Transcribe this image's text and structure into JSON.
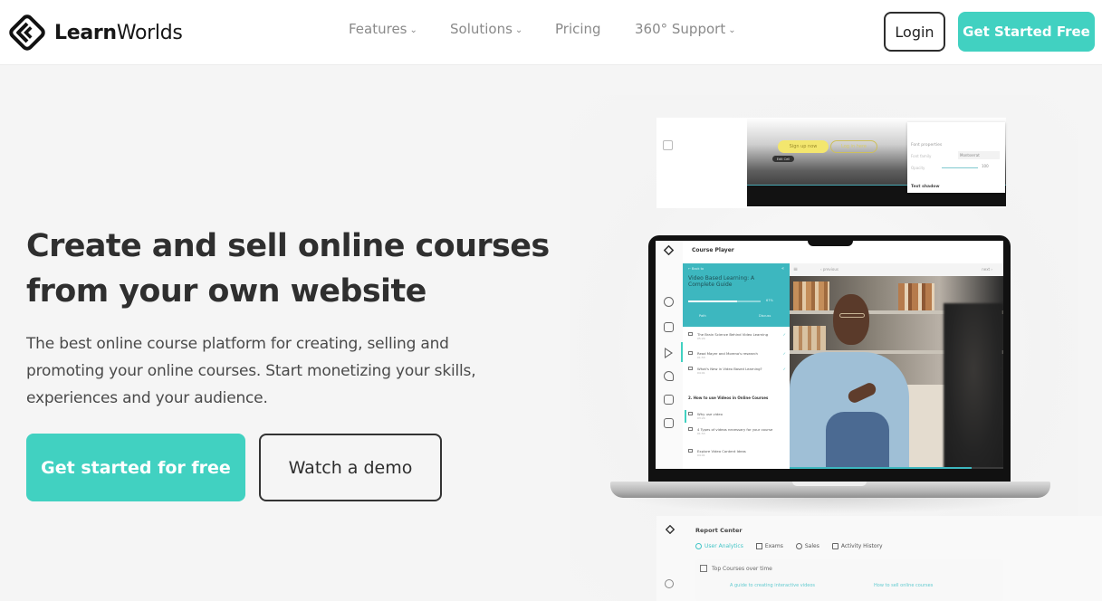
{
  "header": {
    "brand": {
      "bold": "Learn",
      "regular": "Worlds"
    },
    "nav": [
      {
        "label": "Features",
        "has_dropdown": true
      },
      {
        "label": "Solutions",
        "has_dropdown": true
      },
      {
        "label": "Pricing",
        "has_dropdown": false
      },
      {
        "label": "360° Support",
        "has_dropdown": true
      }
    ],
    "login_label": "Login",
    "cta_label": "Get Started Free"
  },
  "hero": {
    "title_line1": "Create and sell online courses",
    "title_line2": "from your own website",
    "subtitle": "The best online course platform for creating, selling and promoting your online courses. Start monetizing your skills, experiences and your audience.",
    "primary_cta": "Get started for free",
    "secondary_cta": "Watch a demo"
  },
  "colors": {
    "accent": "#41d1c1",
    "course_header": "#3db7bf",
    "text_dark": "#2f2f2f",
    "nav_text": "#8a8a8a"
  },
  "builder_preview": {
    "signup_button": "Sign up now",
    "login_button": "Log in here",
    "edit_tag": "Edit Cell",
    "panel_title": "Font properties",
    "font_family_label": "Font family",
    "font_family_value": "Montserrat",
    "opacity_label": "Opacity",
    "opacity_value": "100",
    "text_shadow_label": "Text shadow"
  },
  "course_player": {
    "app_title": "Course Player",
    "back_label": "← Back to",
    "collapse_icon": "«",
    "course_title": "Video Based Learning: A Complete Guide",
    "progress_percent": 67,
    "progress_label": "67%",
    "tabs": [
      "Path",
      "Discuss"
    ],
    "nav_prev": "‹  previous",
    "nav_next": "next  ›",
    "lessons_section1": [
      {
        "title": "The Brain Science Behind Video Learning",
        "duration": "05:24",
        "done": true
      },
      {
        "title": "Read Mayer and Moreno's research",
        "duration": "01:53",
        "done": true
      },
      {
        "title": "What's New in Video Based Learning?",
        "duration": "04:01",
        "done": true
      }
    ],
    "section2_title": "2. How to use Videos in Online Courses",
    "lessons_section2": [
      {
        "title": "Why use video",
        "duration": "03:24",
        "done": false
      },
      {
        "title": "4 Types of videos necessary for your course",
        "duration": "01:53",
        "done": false
      },
      {
        "title": "Explore Video Content Ideas",
        "duration": "04:01",
        "done": false
      }
    ],
    "video_progress_percent": 85
  },
  "report_center": {
    "title": "Report Center",
    "tabs": [
      {
        "label": "User Analytics",
        "active": true
      },
      {
        "label": "Exams",
        "active": false
      },
      {
        "label": "Sales",
        "active": false
      },
      {
        "label": "Activity History",
        "active": false
      }
    ],
    "card_title": "Top Courses over time",
    "links": [
      "A guide to creating interactive videos",
      "How to sell online courses"
    ]
  }
}
